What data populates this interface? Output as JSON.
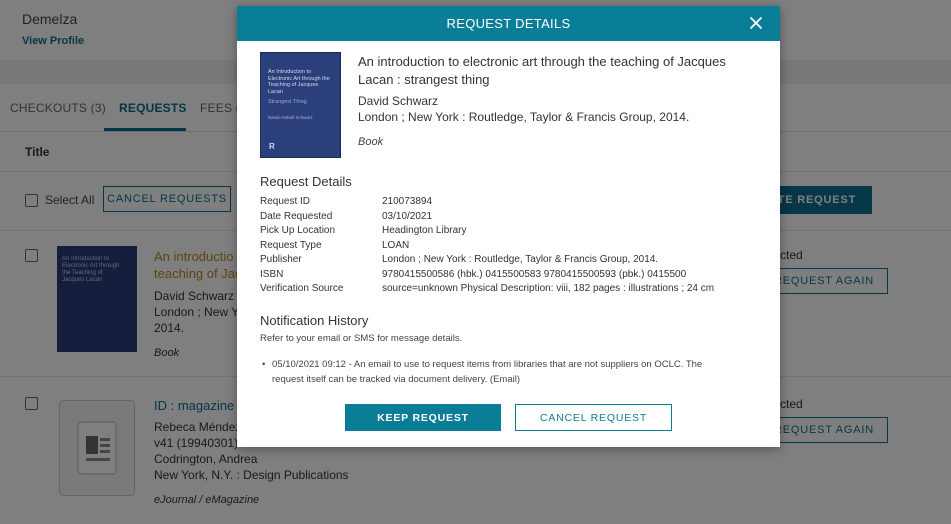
{
  "profile": {
    "name": "Demelza",
    "view_profile": "View Profile"
  },
  "tabs": [
    {
      "label": "CHECKOUTS (3)"
    },
    {
      "label": "REQUESTS"
    },
    {
      "label": "FEES (£"
    }
  ],
  "list": {
    "column_title": "Title",
    "select_all": "Select All",
    "cancel_requests": "CANCEL REQUESTS",
    "create_request": "ATE REQUEST",
    "rows": [
      {
        "title_line1": "An introductio",
        "title_line2": "teaching of Jac",
        "author": "David Schwarz",
        "pub_line1": "London ; New Yo",
        "pub_line2": "2014.",
        "type": "Book",
        "status": "cted",
        "action": "REQUEST AGAIN"
      },
      {
        "title_line1": "ID : magazine c",
        "line2": "Rebeca Méndez",
        "line3": "v41 (19940301)",
        "line4": "Codrington, Andrea",
        "line5": "New York, N.Y. : Design Publications",
        "type": "eJournal / eMagazine",
        "status": "cted",
        "action": "REQUEST AGAIN"
      }
    ]
  },
  "modal": {
    "title": "REQUEST DETAILS",
    "cover": {
      "text": "An Introduction to Electronic Art through the Teaching of Jacques Lacan",
      "subtitle": "Strangest Thing",
      "author": "David Ambell Schwarz",
      "publisher_mark": "R"
    },
    "book_title": "An introduction to electronic art through the teaching of Jacques Lacan : strangest thing",
    "author": "David Schwarz",
    "publication": "London ; New York : Routledge, Taylor & Francis Group, 2014.",
    "type": "Book",
    "details_heading": "Request Details",
    "details": [
      {
        "label": "Request ID",
        "value": "210073894"
      },
      {
        "label": "Date Requested",
        "value": "03/10/2021"
      },
      {
        "label": "Pick Up Location",
        "value": "Headington Library"
      },
      {
        "label": "Request Type",
        "value": "LOAN"
      },
      {
        "label": "Publisher",
        "value": "London ; New York : Routledge, Taylor & Francis Group, 2014."
      },
      {
        "label": "ISBN",
        "value": "9780415500586 (hbk.) 0415500583 9780415500593 (pbk.) 0415500"
      },
      {
        "label": "Verification Source",
        "value": "source=unknown Physical Description: viii, 182 pages : illustrations ; 24 cm"
      }
    ],
    "history_heading": "Notification History",
    "history_note": "Refer to your email or SMS for message details.",
    "history": [
      {
        "text": "05/10/2021 09:12 - An email to use to request items from libraries that are not suppliers on OCLC. The request itself can be tracked via document delivery. (Email)"
      }
    ],
    "keep_label": "KEEP REQUEST",
    "cancel_label": "CANCEL REQUEST"
  }
}
